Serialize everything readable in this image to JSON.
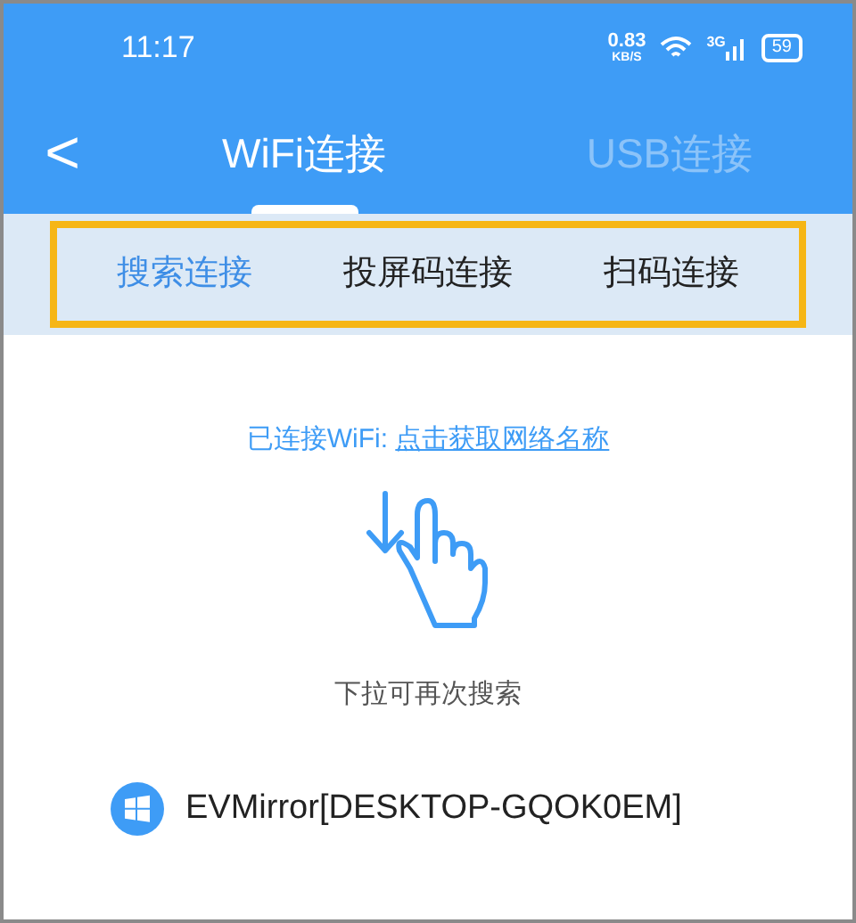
{
  "status_bar": {
    "time": "11:17",
    "speed": "0.83",
    "speed_unit": "KB/S",
    "network": "3G",
    "battery": "59"
  },
  "header": {
    "back": "<",
    "tabs": [
      {
        "label": "WiFi连接",
        "selected": true
      },
      {
        "label": "USB连接",
        "selected": false
      }
    ]
  },
  "sub_tabs": [
    {
      "label": "搜索连接",
      "selected": true
    },
    {
      "label": "投屏码连接",
      "selected": false
    },
    {
      "label": "扫码连接",
      "selected": false
    }
  ],
  "wifi": {
    "label": "已连接WiFi: ",
    "link": "点击获取网络名称"
  },
  "hint": "下拉可再次搜索",
  "devices": [
    {
      "name": "EVMirror[DESKTOP-GQOK0EM]"
    }
  ]
}
